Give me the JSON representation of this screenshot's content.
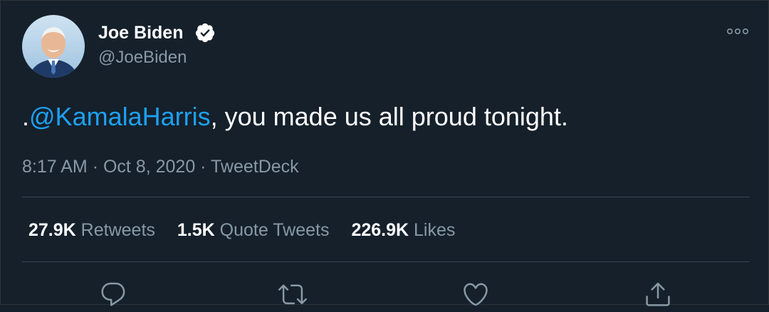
{
  "author": {
    "name": "Joe Biden",
    "handle": "@JoeBiden",
    "verified": true
  },
  "tweet": {
    "prefix": ".",
    "mention": "@KamalaHarris",
    "text": ", you made us all proud tonight."
  },
  "meta": {
    "time": "8:17 AM",
    "separator": "·",
    "date": "Oct 8, 2020",
    "source": "TweetDeck"
  },
  "stats": {
    "retweets": {
      "value": "27.9K",
      "label": "Retweets"
    },
    "quote_tweets": {
      "value": "1.5K",
      "label": "Quote Tweets"
    },
    "likes": {
      "value": "226.9K",
      "label": "Likes"
    }
  },
  "actions": {
    "reply_icon": "reply-icon",
    "retweet_icon": "retweet-icon",
    "like_icon": "heart-icon",
    "share_icon": "share-icon"
  },
  "colors": {
    "background": "#15202b",
    "accent": "#1da1f2",
    "secondary_text": "#8899a6",
    "divider": "#38444d"
  }
}
